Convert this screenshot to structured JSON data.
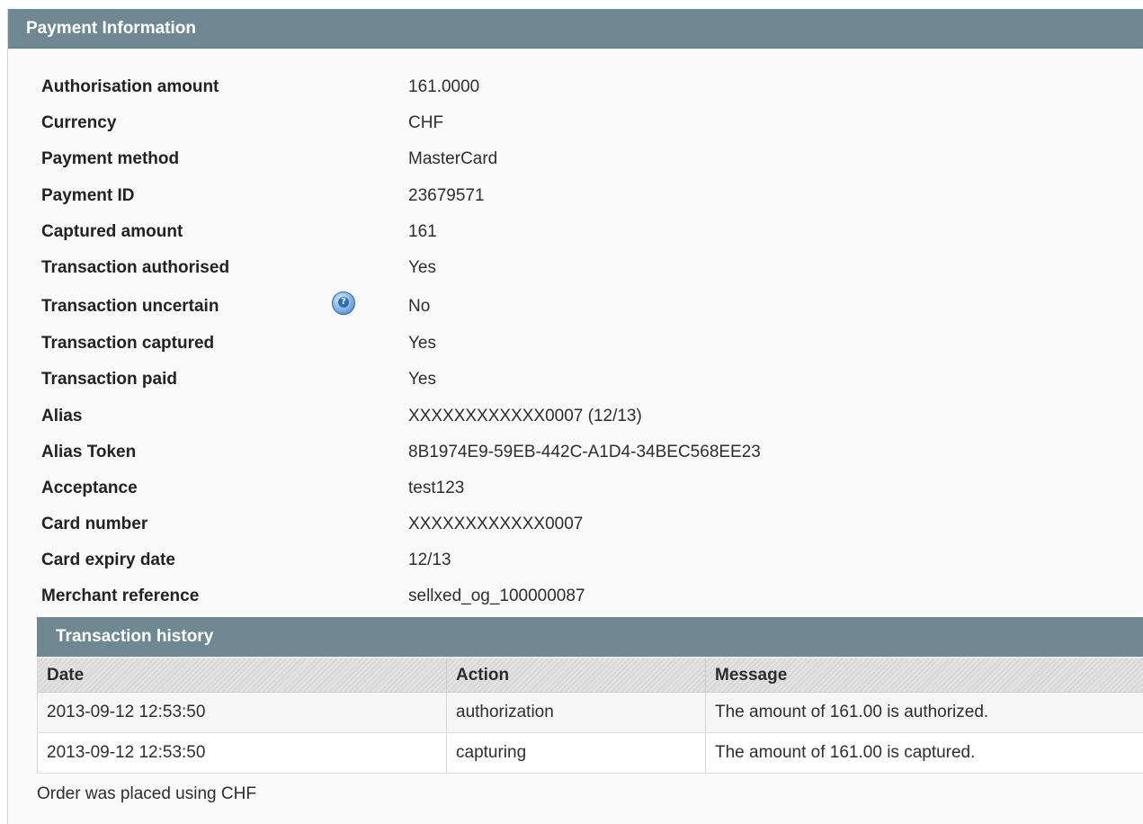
{
  "panel": {
    "title": "Payment Information"
  },
  "info_rows": [
    {
      "label": "Authorisation amount",
      "value": "161.0000"
    },
    {
      "label": "Currency",
      "value": "CHF"
    },
    {
      "label": "Payment method",
      "value": "MasterCard"
    },
    {
      "label": "Payment ID",
      "value": "23679571"
    },
    {
      "label": "Captured amount",
      "value": "161"
    },
    {
      "label": "Transaction authorised",
      "value": "Yes"
    },
    {
      "label": "Transaction uncertain",
      "value": "No",
      "icon": "help-icon"
    },
    {
      "label": "Transaction captured",
      "value": "Yes"
    },
    {
      "label": "Transaction paid",
      "value": "Yes"
    },
    {
      "label": "Alias",
      "value": "XXXXXXXXXXXX0007 (12/13)"
    },
    {
      "label": "Alias Token",
      "value": "8B1974E9-59EB-442C-A1D4-34BEC568EE23"
    },
    {
      "label": "Acceptance",
      "value": "test123"
    },
    {
      "label": "Card number",
      "value": "XXXXXXXXXXXX0007"
    },
    {
      "label": "Card expiry date",
      "value": "12/13"
    },
    {
      "label": "Merchant reference",
      "value": "sellxed_og_100000087"
    }
  ],
  "history": {
    "title": "Transaction history",
    "columns": [
      "Date",
      "Action",
      "Message"
    ],
    "rows": [
      [
        "2013-09-12 12:53:50",
        "authorization",
        "The amount of 161.00 is authorized."
      ],
      [
        "2013-09-12 12:53:50",
        "capturing",
        "The amount of 161.00 is captured."
      ]
    ]
  },
  "footer_note": "Order was placed using CHF",
  "colors": {
    "header_bg": "#6f8992",
    "panel_bg": "#fafafa"
  }
}
